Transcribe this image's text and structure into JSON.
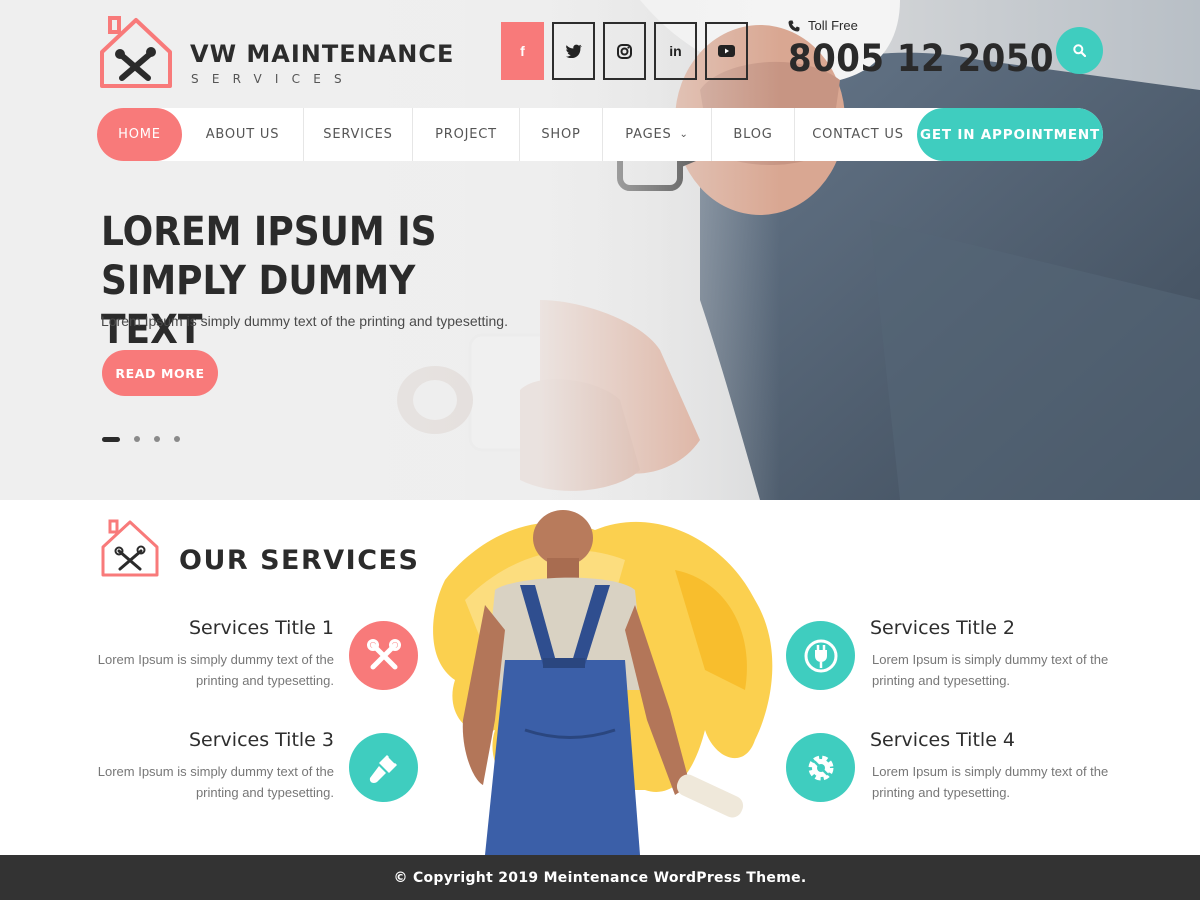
{
  "brand": {
    "title": "VW MAINTENANCE",
    "subtitle": "SERVICES",
    "logo_icon": "house-tools-icon",
    "accent_coral": "#f87a7a",
    "accent_teal": "#3fcdbf"
  },
  "header": {
    "social": [
      {
        "name": "facebook",
        "glyph": "f"
      },
      {
        "name": "twitter",
        "glyph": "t"
      },
      {
        "name": "instagram",
        "glyph": "◎"
      },
      {
        "name": "linkedin",
        "glyph": "in"
      },
      {
        "name": "youtube",
        "glyph": "▶"
      }
    ],
    "phone_label": "Toll Free",
    "phone_number": "8005 12 2050",
    "search_icon": "search-icon"
  },
  "nav": {
    "items": [
      "HOME",
      "ABOUT US",
      "SERVICES",
      "PROJECT",
      "SHOP",
      "PAGES",
      "BLOG",
      "CONTACT US"
    ],
    "cta": "GET IN APPOINTMENT"
  },
  "hero": {
    "title": "LOREM IPSUM IS SIMPLY DUMMY TEXT",
    "subtitle": "Lorem Ipsum is simply dummy text of the printing and typesetting.",
    "button": "READ MORE",
    "slides": 4,
    "active_slide": 1
  },
  "services": {
    "heading": "OUR SERVICES",
    "items": [
      {
        "title": "Services Title 1",
        "text": "Lorem Ipsum is simply dummy text of the printing and typesetting.",
        "icon": "tools-icon"
      },
      {
        "title": "Services Title 2",
        "text": "Lorem Ipsum is simply dummy text of the printing and typesetting.",
        "icon": "plug-icon"
      },
      {
        "title": "Services Title 3",
        "text": "Lorem Ipsum is simply dummy text of the printing and typesetting.",
        "icon": "paint-brush-icon"
      },
      {
        "title": "Services Title 4",
        "text": "Lorem Ipsum is simply dummy text of the printing and typesetting.",
        "icon": "gear-wrench-icon"
      }
    ]
  },
  "footer": {
    "copyright": "© Copyright 2019 Meintenance WordPress Theme."
  }
}
